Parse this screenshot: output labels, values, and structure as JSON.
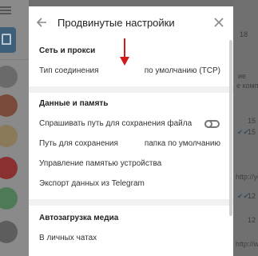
{
  "dialog": {
    "title": "Продвинутые настройки",
    "back_icon": "arrow-left-icon",
    "close_icon": "close-icon"
  },
  "network": {
    "section_title": "Сеть и прокси",
    "connection_type_label": "Тип соединения",
    "connection_type_value": "по умолчанию (TCP)"
  },
  "data_storage": {
    "section_title": "Данные и память",
    "ask_path_label": "Спрашивать путь для сохранения файла",
    "ask_path_enabled": false,
    "save_path_label": "Путь для сохранения",
    "save_path_value": "папка по умолчанию",
    "manage_storage_label": "Управление памятью устройства",
    "export_label": "Экспорт данных из Telegram"
  },
  "autodownload": {
    "section_title": "Автозагрузка медиа",
    "private_chats_label": "В личных чатах"
  },
  "annotation": {
    "color": "#d11a1a",
    "icon": "red-arrow-down-icon"
  },
  "background": {
    "snippets": [
      "ие",
      "е компа",
      "ie",
      "http://youtu",
      "http://www"
    ],
    "times": [
      "18",
      "15",
      "15",
      "12",
      "12"
    ]
  }
}
